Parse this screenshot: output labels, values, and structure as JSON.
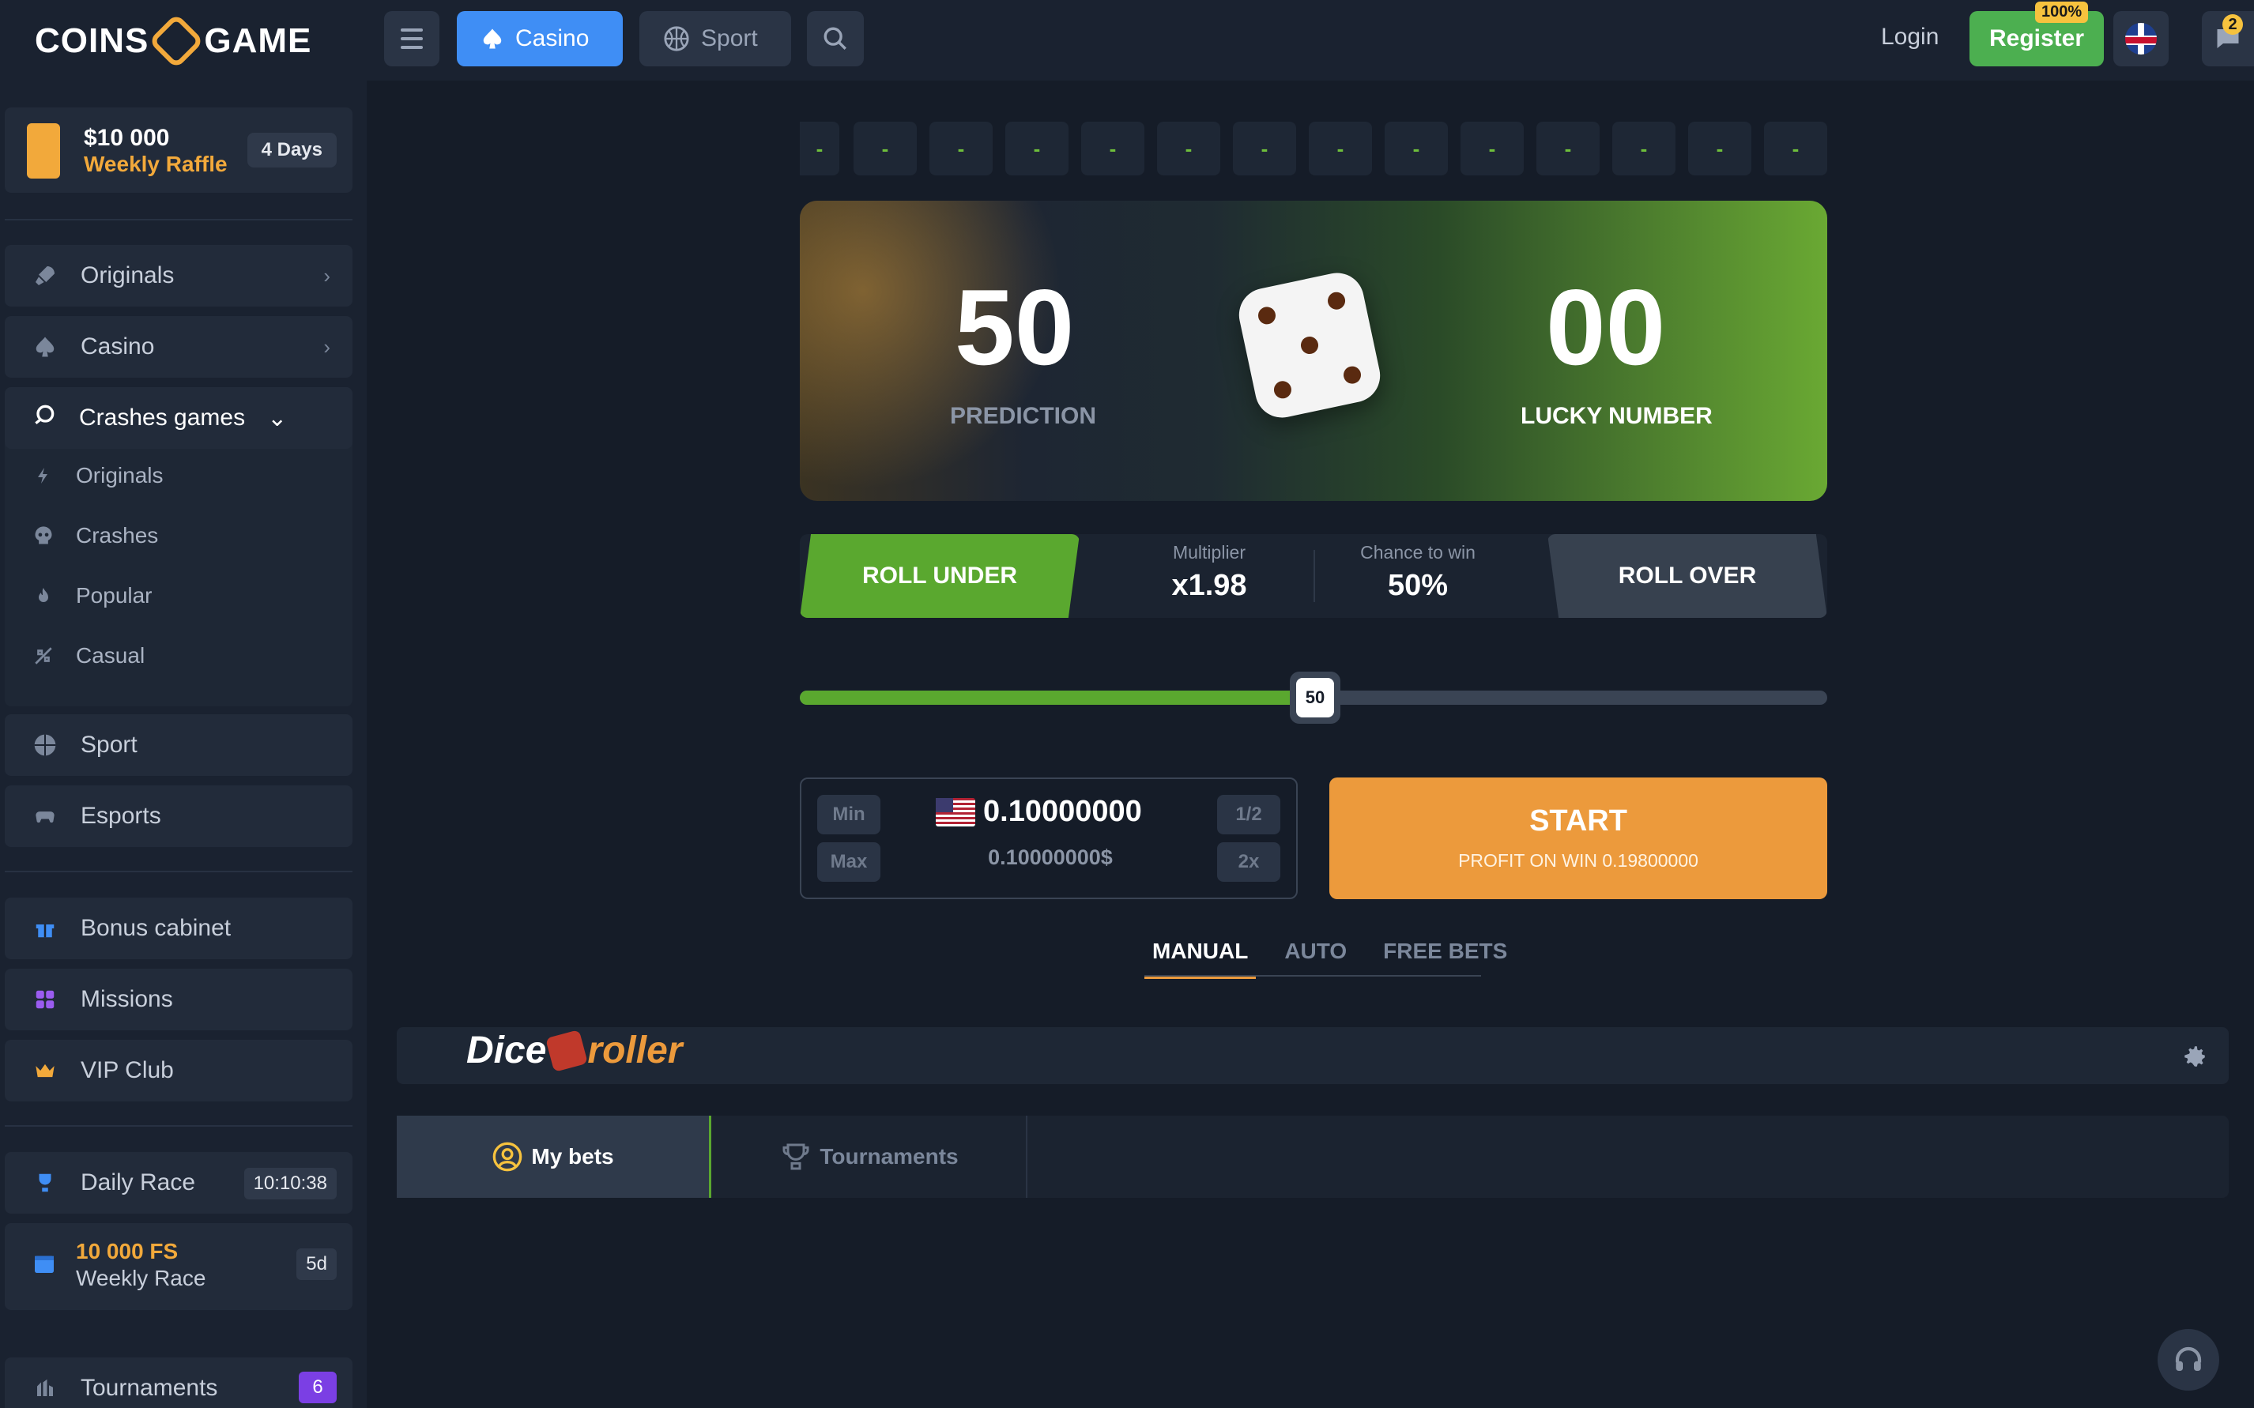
{
  "header": {
    "logo": "COINS GAME",
    "tabs": [
      {
        "label": "Casino",
        "active": true
      },
      {
        "label": "Sport",
        "active": false
      }
    ],
    "login_label": "Login",
    "register_label": "Register",
    "register_badge": "100%",
    "chat_badge": "2"
  },
  "sidebar": {
    "raffle": {
      "amount": "$10 000",
      "label": "Weekly Raffle",
      "days": "4 Days"
    },
    "nav": [
      {
        "label": "Originals",
        "icon": "rocket-icon"
      },
      {
        "label": "Casino",
        "icon": "spade-icon"
      }
    ],
    "crash_group": {
      "label": "Crashes games",
      "items": [
        "Originals",
        "Crashes",
        "Popular",
        "Casual"
      ]
    },
    "nav2": [
      "Sport",
      "Esports"
    ],
    "nav3": [
      "Bonus cabinet",
      "Missions",
      "VIP Club"
    ],
    "daily_race": {
      "label": "Daily Race",
      "time": "10:10:38"
    },
    "weekly_race": {
      "fs": "10 000 FS",
      "label": "Weekly Race",
      "days": "5d"
    },
    "tournaments": {
      "label": "Tournaments",
      "count": "6"
    }
  },
  "history": [
    "-",
    "-",
    "-",
    "-",
    "-",
    "-",
    "-",
    "-",
    "-",
    "-",
    "-",
    "-",
    "-",
    "-"
  ],
  "game": {
    "prediction": "50",
    "prediction_label": "PREDICTION",
    "lucky_number": "00",
    "lucky_label": "LUCKY NUMBER",
    "roll_under": "ROLL UNDER",
    "roll_over": "ROLL OVER",
    "multiplier_label": "Multiplier",
    "multiplier": "x1.98",
    "chance_label": "Chance to win",
    "chance": "50%",
    "slider_value": "50",
    "slider_percent": 50
  },
  "bet": {
    "min": "Min",
    "max": "Max",
    "half": "1/2",
    "double": "2x",
    "amount": "0.10000000",
    "amount_usd": "0.10000000$",
    "start": "START",
    "profit": "PROFIT ON WIN 0.19800000"
  },
  "modes": [
    "MANUAL",
    "AUTO",
    "FREE BETS"
  ],
  "brand": {
    "left": "Dice",
    "right": "roller"
  },
  "bets_tabs": [
    "My bets",
    "Tournaments"
  ],
  "colors": {
    "accent_green": "#5aa82f",
    "accent_orange": "#ec9a3c",
    "primary_blue": "#3f8ef5"
  }
}
